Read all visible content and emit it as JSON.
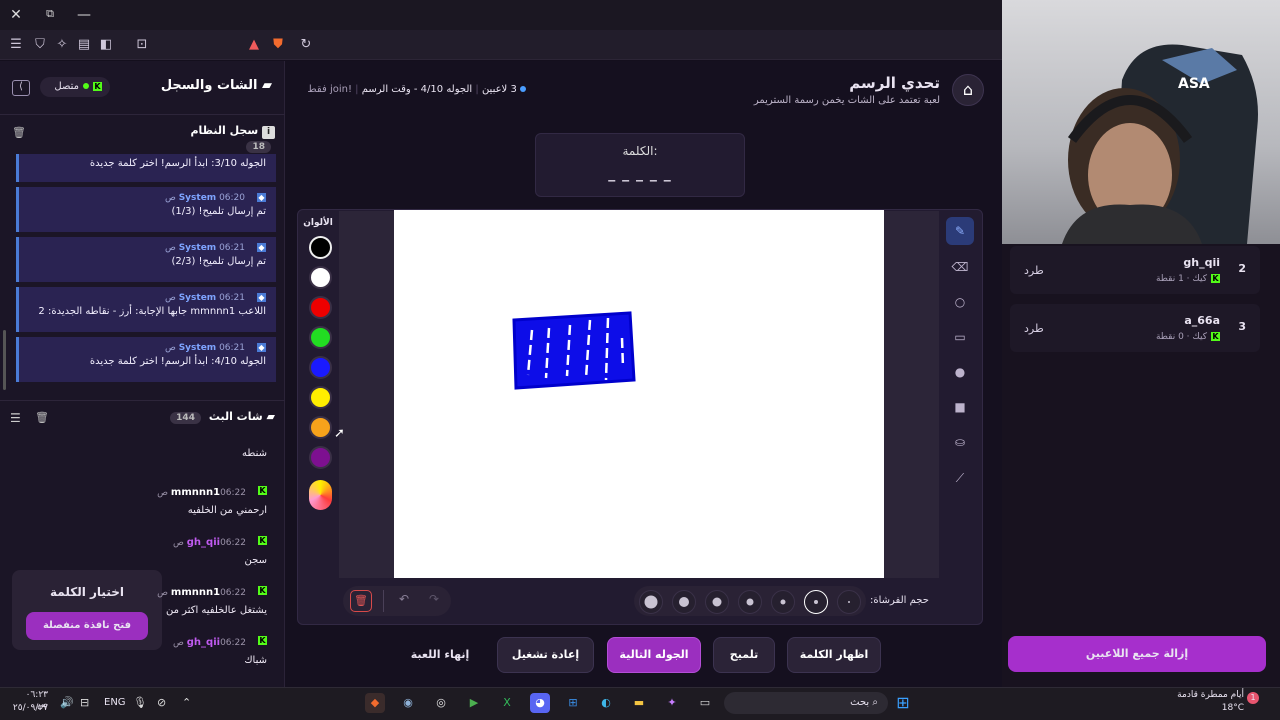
{
  "browser": {
    "url": "jawlah.live/games/drawing-challenge?kick=iguzm"
  },
  "header": {
    "title": "تحدي الرسم",
    "subtitle": "لعبة تعتمد على الشات يخمن رسمة الستريمر",
    "players_count": "3 لاعبين",
    "round_info": "الجوله 4/10 - وقت الرسم",
    "join_hint": "!join فقط"
  },
  "word_box": {
    "label": "الكلمة:",
    "masked": "_ _ _ _ _"
  },
  "palette": {
    "title": "الألوان",
    "colors": [
      "#000000",
      "#ffffff",
      "#ee0000",
      "#22dd22",
      "#1a1aff",
      "#ffee00",
      "#f7a21b",
      "#7d1090"
    ]
  },
  "canvas_footer": {
    "brush_size_label": "حجم الفرشاة:"
  },
  "actions": {
    "show_word": "اظهار الكلمة",
    "hint": "تلميح",
    "next_round": "الجوله التالية",
    "restart": "إعادة تشغيل",
    "end_game": "إنهاء اللعبة"
  },
  "left": {
    "title": "الشات والسجل",
    "status": "متصل",
    "system_log": {
      "title": "سجل النظام",
      "count": "18",
      "first_line": "الجوله 3/10: ابدأ الرسم! اختر كلمة جديدة",
      "messages": [
        {
          "user": "System",
          "time": "06:20 ص",
          "text": "تم إرسال تلميح! (1/3)"
        },
        {
          "user": "System",
          "time": "06:21 ص",
          "text": "تم إرسال تلميح! (2/3)"
        },
        {
          "user": "System",
          "time": "06:21 ص",
          "text": "اللاعب mmnnn1 جابها الإجابة: أرز - نقاطه الجديدة: 2"
        },
        {
          "user": "System",
          "time": "06:21 ص",
          "text": "الجوله 4/10: ابدأ الرسم! اختر كلمة جديدة"
        }
      ]
    },
    "stream_chat": {
      "title": "شات البث",
      "count": "144",
      "first_text": "شنطه",
      "messages": [
        {
          "user": "mmnnn1",
          "time": "06:22 ص",
          "text": "ارحمني من الخلفيه"
        },
        {
          "user": "gh_qii",
          "time": "06:22 ص",
          "text": "سجن"
        },
        {
          "user": "mmnnn1",
          "time": "06:22 ص",
          "text": "يشتغل عالخلفيه اكثر من"
        },
        {
          "user": "gh_qii",
          "time": "06:22 ص",
          "text": "شباك"
        }
      ]
    },
    "word_choice": {
      "title": "اختيار الكلمة",
      "button": "فتح نافذة منفصلة"
    }
  },
  "players": {
    "rows": [
      {
        "rank": "2",
        "name": "gh_qii",
        "platform": "كيك",
        "points": "1 نقطة",
        "kick": "طرد"
      },
      {
        "rank": "3",
        "name": "a_66a",
        "platform": "كيك",
        "points": "0 نقطة",
        "kick": "طرد"
      }
    ],
    "remove_all": "إزالة جميع اللاعبين"
  },
  "webcam": {
    "brand": "ASA"
  },
  "taskbar": {
    "search": "بحث",
    "weather_text": "أيام ممطرة قادمة",
    "temp": "18°C",
    "lang": "ENG",
    "time": "٠٦:٢٣ ص",
    "date": "٢٥/٠٩/٢٧",
    "badge": "1"
  }
}
